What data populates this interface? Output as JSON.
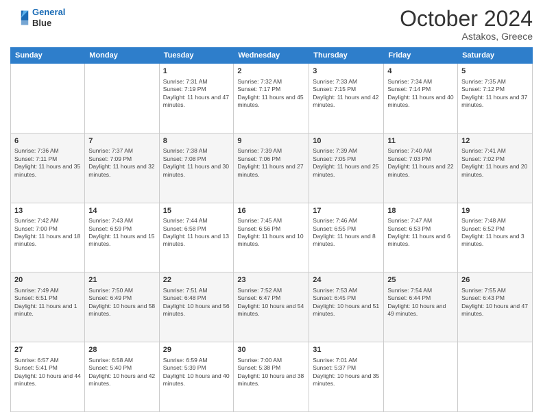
{
  "logo": {
    "line1": "General",
    "line2": "Blue"
  },
  "title": "October 2024",
  "subtitle": "Astakos, Greece",
  "days_of_week": [
    "Sunday",
    "Monday",
    "Tuesday",
    "Wednesday",
    "Thursday",
    "Friday",
    "Saturday"
  ],
  "weeks": [
    [
      {
        "day": "",
        "info": ""
      },
      {
        "day": "",
        "info": ""
      },
      {
        "day": "1",
        "info": "Sunrise: 7:31 AM\nSunset: 7:19 PM\nDaylight: 11 hours and 47 minutes."
      },
      {
        "day": "2",
        "info": "Sunrise: 7:32 AM\nSunset: 7:17 PM\nDaylight: 11 hours and 45 minutes."
      },
      {
        "day": "3",
        "info": "Sunrise: 7:33 AM\nSunset: 7:15 PM\nDaylight: 11 hours and 42 minutes."
      },
      {
        "day": "4",
        "info": "Sunrise: 7:34 AM\nSunset: 7:14 PM\nDaylight: 11 hours and 40 minutes."
      },
      {
        "day": "5",
        "info": "Sunrise: 7:35 AM\nSunset: 7:12 PM\nDaylight: 11 hours and 37 minutes."
      }
    ],
    [
      {
        "day": "6",
        "info": "Sunrise: 7:36 AM\nSunset: 7:11 PM\nDaylight: 11 hours and 35 minutes."
      },
      {
        "day": "7",
        "info": "Sunrise: 7:37 AM\nSunset: 7:09 PM\nDaylight: 11 hours and 32 minutes."
      },
      {
        "day": "8",
        "info": "Sunrise: 7:38 AM\nSunset: 7:08 PM\nDaylight: 11 hours and 30 minutes."
      },
      {
        "day": "9",
        "info": "Sunrise: 7:39 AM\nSunset: 7:06 PM\nDaylight: 11 hours and 27 minutes."
      },
      {
        "day": "10",
        "info": "Sunrise: 7:39 AM\nSunset: 7:05 PM\nDaylight: 11 hours and 25 minutes."
      },
      {
        "day": "11",
        "info": "Sunrise: 7:40 AM\nSunset: 7:03 PM\nDaylight: 11 hours and 22 minutes."
      },
      {
        "day": "12",
        "info": "Sunrise: 7:41 AM\nSunset: 7:02 PM\nDaylight: 11 hours and 20 minutes."
      }
    ],
    [
      {
        "day": "13",
        "info": "Sunrise: 7:42 AM\nSunset: 7:00 PM\nDaylight: 11 hours and 18 minutes."
      },
      {
        "day": "14",
        "info": "Sunrise: 7:43 AM\nSunset: 6:59 PM\nDaylight: 11 hours and 15 minutes."
      },
      {
        "day": "15",
        "info": "Sunrise: 7:44 AM\nSunset: 6:58 PM\nDaylight: 11 hours and 13 minutes."
      },
      {
        "day": "16",
        "info": "Sunrise: 7:45 AM\nSunset: 6:56 PM\nDaylight: 11 hours and 10 minutes."
      },
      {
        "day": "17",
        "info": "Sunrise: 7:46 AM\nSunset: 6:55 PM\nDaylight: 11 hours and 8 minutes."
      },
      {
        "day": "18",
        "info": "Sunrise: 7:47 AM\nSunset: 6:53 PM\nDaylight: 11 hours and 6 minutes."
      },
      {
        "day": "19",
        "info": "Sunrise: 7:48 AM\nSunset: 6:52 PM\nDaylight: 11 hours and 3 minutes."
      }
    ],
    [
      {
        "day": "20",
        "info": "Sunrise: 7:49 AM\nSunset: 6:51 PM\nDaylight: 11 hours and 1 minute."
      },
      {
        "day": "21",
        "info": "Sunrise: 7:50 AM\nSunset: 6:49 PM\nDaylight: 10 hours and 58 minutes."
      },
      {
        "day": "22",
        "info": "Sunrise: 7:51 AM\nSunset: 6:48 PM\nDaylight: 10 hours and 56 minutes."
      },
      {
        "day": "23",
        "info": "Sunrise: 7:52 AM\nSunset: 6:47 PM\nDaylight: 10 hours and 54 minutes."
      },
      {
        "day": "24",
        "info": "Sunrise: 7:53 AM\nSunset: 6:45 PM\nDaylight: 10 hours and 51 minutes."
      },
      {
        "day": "25",
        "info": "Sunrise: 7:54 AM\nSunset: 6:44 PM\nDaylight: 10 hours and 49 minutes."
      },
      {
        "day": "26",
        "info": "Sunrise: 7:55 AM\nSunset: 6:43 PM\nDaylight: 10 hours and 47 minutes."
      }
    ],
    [
      {
        "day": "27",
        "info": "Sunrise: 6:57 AM\nSunset: 5:41 PM\nDaylight: 10 hours and 44 minutes."
      },
      {
        "day": "28",
        "info": "Sunrise: 6:58 AM\nSunset: 5:40 PM\nDaylight: 10 hours and 42 minutes."
      },
      {
        "day": "29",
        "info": "Sunrise: 6:59 AM\nSunset: 5:39 PM\nDaylight: 10 hours and 40 minutes."
      },
      {
        "day": "30",
        "info": "Sunrise: 7:00 AM\nSunset: 5:38 PM\nDaylight: 10 hours and 38 minutes."
      },
      {
        "day": "31",
        "info": "Sunrise: 7:01 AM\nSunset: 5:37 PM\nDaylight: 10 hours and 35 minutes."
      },
      {
        "day": "",
        "info": ""
      },
      {
        "day": "",
        "info": ""
      }
    ]
  ]
}
